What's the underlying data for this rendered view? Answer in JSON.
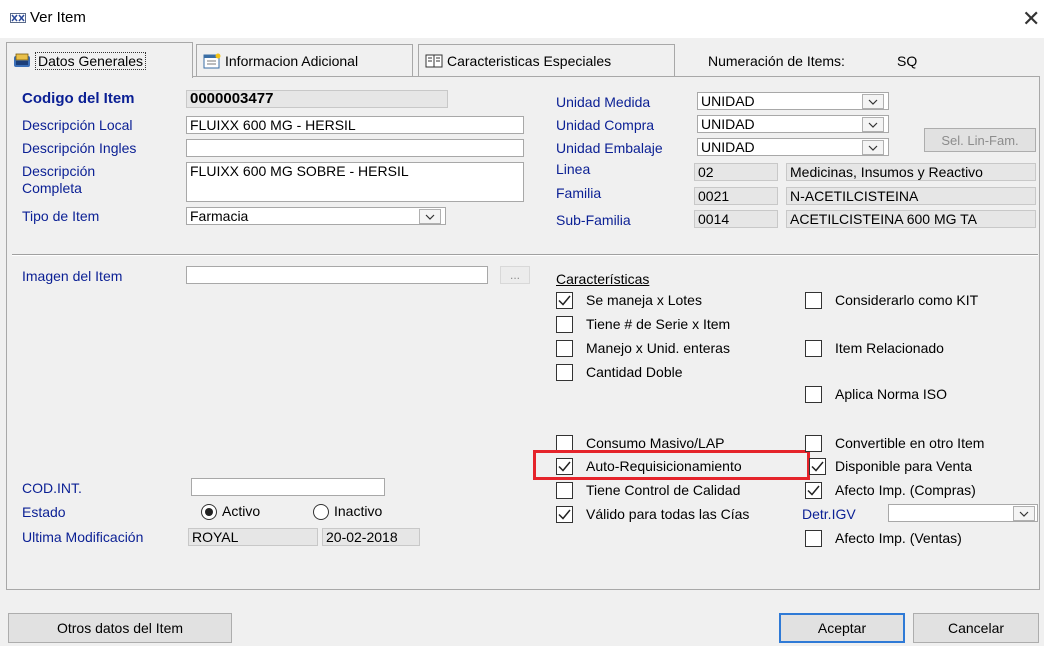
{
  "window": {
    "title": "Ver Item"
  },
  "tabs": [
    {
      "label": "Datos Generales",
      "icon": "datos-generales-icon"
    },
    {
      "label": "Informacion Adicional",
      "icon": "info-adicional-icon"
    },
    {
      "label": "Caracteristicas Especiales",
      "icon": "caracteristicas-icon"
    }
  ],
  "numeracion": {
    "label": "Numeración de Items:",
    "value": "SQ"
  },
  "general": {
    "codigo_label": "Codigo del Item",
    "codigo_value": "0000003477",
    "desc_local_label": "Descripción Local",
    "desc_local_value": "FLUIXX 600 MG - HERSIL",
    "desc_ingles_label": "Descripción Ingles",
    "desc_ingles_value": "",
    "desc_completa_label_1": "Descripción",
    "desc_completa_label_2": "Completa",
    "desc_completa_value": "FLUIXX 600 MG SOBRE - HERSIL",
    "tipo_label": "Tipo de Item",
    "tipo_value": "Farmacia"
  },
  "unidades": {
    "medida_label": "Unidad Medida",
    "medida_value": "UNIDAD",
    "compra_label": "Unidad Compra",
    "compra_value": "UNIDAD",
    "embalaje_label": "Unidad Embalaje",
    "embalaje_value": "UNIDAD",
    "sel_lin_fam": "Sel. Lin-Fam."
  },
  "clasificacion": {
    "linea_label": "Linea",
    "linea_code": "02",
    "linea_desc": "Medicinas, Insumos y Reactivo",
    "familia_label": "Familia",
    "familia_code": "0021",
    "familia_desc": "N-ACETILCISTEINA",
    "subfamilia_label": "Sub-Familia",
    "subfamilia_code": "0014",
    "subfamilia_desc": "ACETILCISTEINA 600 MG TA"
  },
  "imagen": {
    "label": "Imagen del Item",
    "value": "",
    "browse": "..."
  },
  "caracteristicas_title": "Características",
  "checks": {
    "lotes": {
      "label": "Se maneja x Lotes",
      "checked": true
    },
    "serie": {
      "label": "Tiene # de Serie x Item",
      "checked": false
    },
    "unid_enteras": {
      "label": "Manejo x Unid. enteras",
      "checked": false
    },
    "cantidad_doble": {
      "label": "Cantidad Doble",
      "checked": false
    },
    "consumo_masivo": {
      "label": "Consumo Masivo/LAP",
      "checked": false
    },
    "auto_req": {
      "label": "Auto-Requisicionamiento",
      "checked": true
    },
    "control_calidad": {
      "label": "Tiene Control de Calidad",
      "checked": false
    },
    "valido_cias": {
      "label": "Válido para todas las Cías",
      "checked": true
    },
    "kit": {
      "label": "Considerarlo como KIT",
      "checked": false
    },
    "relacionado": {
      "label": "Item Relacionado",
      "checked": false
    },
    "norma_iso": {
      "label": "Aplica Norma ISO",
      "checked": false
    },
    "convertible": {
      "label": "Convertible en otro Item",
      "checked": false
    },
    "disponible_venta": {
      "label": "Disponible para Venta",
      "checked": true
    },
    "afecto_compras": {
      "label": "Afecto Imp. (Compras)",
      "checked": true
    },
    "afecto_ventas": {
      "label": "Afecto Imp. (Ventas)",
      "checked": false
    }
  },
  "detr_igv": {
    "label": "Detr.IGV",
    "value": ""
  },
  "codint": {
    "label": "COD.INT.",
    "value": ""
  },
  "estado": {
    "label": "Estado",
    "activo": "Activo",
    "inactivo": "Inactivo",
    "selected": "Activo"
  },
  "modificacion": {
    "label": "Ultima Modificación",
    "user": "ROYAL",
    "date": "20-02-2018"
  },
  "buttons": {
    "otros": "Otros datos del Item",
    "aceptar": "Aceptar",
    "cancelar": "Cancelar"
  },
  "colors": {
    "label_blue": "#0a1f94",
    "highlight": "#e5242b",
    "primary_border": "#2f7ad6"
  }
}
